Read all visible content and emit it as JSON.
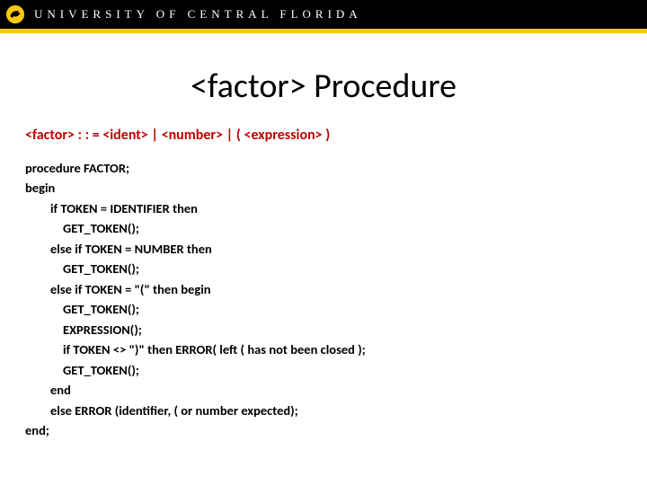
{
  "header": {
    "university": "UNIVERSITY OF CENTRAL FLORIDA"
  },
  "title": "<factor> Procedure",
  "grammar": "<factor> : : = <ident> | <number> | ( <expression> )",
  "code": {
    "l1": "procedure FACTOR;",
    "l2": "begin",
    "l3": "if TOKEN = IDENTIFIER then",
    "l4": "GET_TOKEN();",
    "l5": "else if TOKEN = NUMBER then",
    "l6": "GET_TOKEN();",
    "l7": "else if TOKEN = \"(\" then begin",
    "l8": "GET_TOKEN();",
    "l9": "EXPRESSION();",
    "l10": "if TOKEN <> \")\" then ERROR( left ( has not been closed  );",
    "l11": "GET_TOKEN();",
    "l12": "end",
    "l13": "else ERROR (identifier, ( or number expected);",
    "l14": "end;"
  }
}
